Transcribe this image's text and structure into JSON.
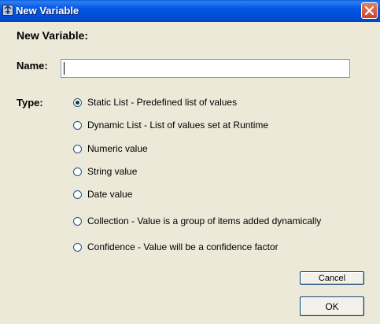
{
  "window": {
    "title": "New Variable",
    "icon": "app-icon",
    "close_icon": "close-icon"
  },
  "form": {
    "heading": "New Variable:",
    "name_label": "Name:",
    "name_value": "",
    "type_label": "Type:",
    "options": [
      {
        "label": "Static List - Predefined list of values",
        "checked": true
      },
      {
        "label": "Dynamic List - List of values set at Runtime",
        "checked": false
      },
      {
        "label": "Numeric value",
        "checked": false
      },
      {
        "label": "String value",
        "checked": false
      },
      {
        "label": "Date value",
        "checked": false
      },
      {
        "label": "Collection - Value is a group of items added dynamically",
        "checked": false
      },
      {
        "label": "Confidence - Value will be a confidence factor",
        "checked": false
      }
    ]
  },
  "buttons": {
    "cancel": "Cancel",
    "ok": "OK"
  },
  "colors": {
    "titlebar": "#0055e5",
    "background": "#ece9d8",
    "close_button": "#c8452a"
  }
}
